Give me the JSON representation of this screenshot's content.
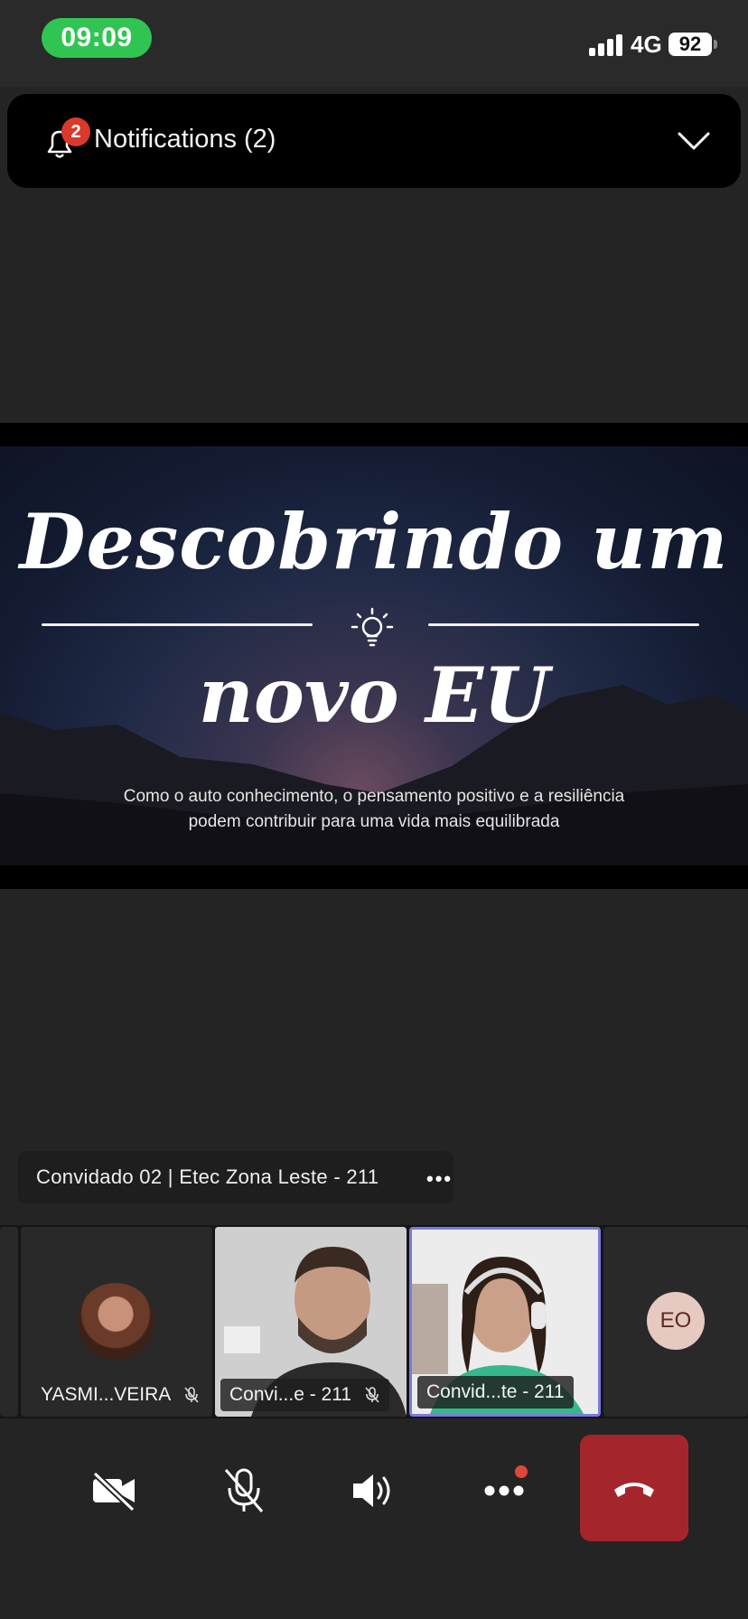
{
  "status_bar": {
    "time": "09:09",
    "network": "4G",
    "battery": "92"
  },
  "notifications": {
    "badge": "2",
    "label": "Notifications (2)"
  },
  "presentation": {
    "title_line1": "Descobrindo um",
    "title_line2": "novo EU",
    "subtitle_line1": "Como o auto conhecimento, o pensamento positivo e a resiliência",
    "subtitle_line2": "podem contribuir para uma vida mais equilibrada"
  },
  "active_speaker": {
    "name": "Convidado 02 | Etec Zona Leste - 211",
    "more": "•••"
  },
  "participants": [
    {
      "label": "YASMI...VEIRA",
      "muted": true
    },
    {
      "label": "Convi...e - 211",
      "muted": true
    },
    {
      "label": "Convid...te - 211",
      "muted": false,
      "speaking": true
    },
    {
      "initials": "EO"
    }
  ],
  "colors": {
    "time_pill": "#30c552",
    "badge": "#d93a2b",
    "speaking_border": "#7a7ae0",
    "hangup": "#a4262c"
  },
  "controls": {
    "camera_icon": "camera-off-icon",
    "mic_icon": "mic-off-icon",
    "speaker_icon": "speaker-icon",
    "more_icon": "more-icon",
    "hangup_icon": "hang-up-icon"
  }
}
